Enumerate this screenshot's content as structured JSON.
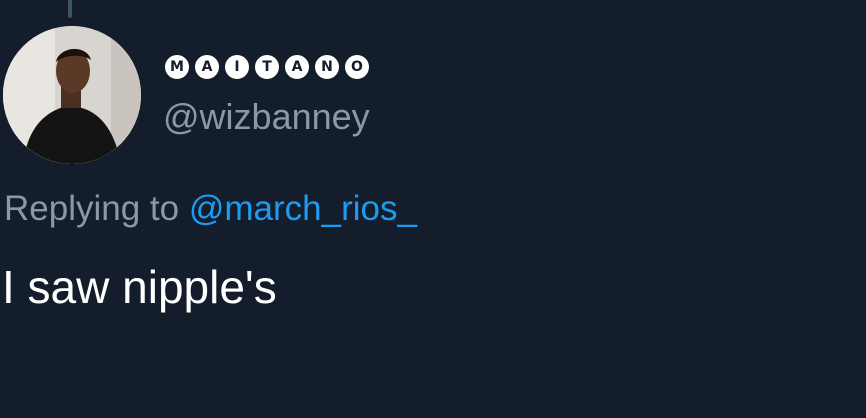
{
  "tweet": {
    "display_name_letters": [
      "M",
      "A",
      "I",
      "T",
      "A",
      "N",
      "O"
    ],
    "handle": "@wizbanney",
    "replying_prefix": "Replying to",
    "replying_to": "@march_rios_",
    "text": "I saw nipple's"
  },
  "colors": {
    "background": "#141d2b",
    "secondary_text": "#8b98a5",
    "link": "#1d9bf0",
    "primary_text": "#ffffff"
  }
}
